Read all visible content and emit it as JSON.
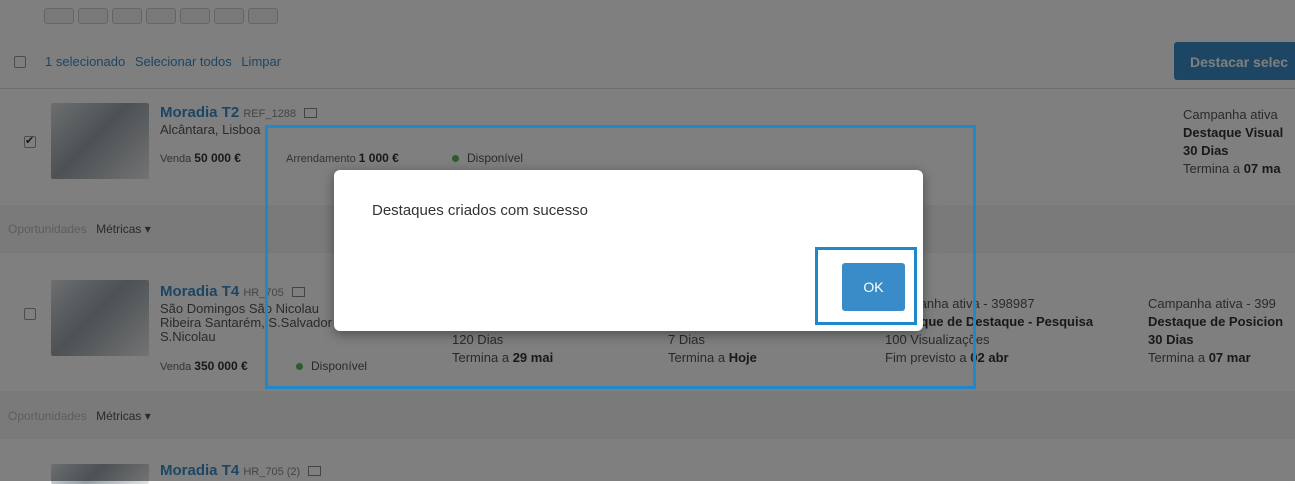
{
  "selection_bar": {
    "selected_count": "1 selecionado",
    "select_all": "Selecionar todos",
    "clear": "Limpar",
    "highlight_button": "Destacar selec"
  },
  "listings": [
    {
      "title": "Moradia T2",
      "ref": "REF_1288",
      "location": "Alcântara, Lisboa",
      "sale_label": "Venda",
      "sale_price": "50 000 €",
      "rent_label": "Arrendamento",
      "rent_price": "1 000 €",
      "status": "Disponível",
      "campaign": {
        "line1": "Campanha ativa",
        "line2": "Destaque Visual",
        "line3": "30 Dias",
        "line4_prefix": "Termina a",
        "line4_value": "07 ma"
      },
      "tabs": {
        "opportunities": "Oportunidades",
        "metrics": "Métricas ▾"
      }
    },
    {
      "title": "Moradia T4",
      "ref": "HR_705",
      "location_lines": [
        "São Domingos São Nicolau",
        "Ribeira Santarém, S.Salvador",
        "S.Nicolau"
      ],
      "sale_label": "Venda",
      "sale_price": "350 000 €",
      "status": "Disponível",
      "col_a": {
        "line3": "120 Dias",
        "line4_prefix": "Termina a",
        "line4_value": "29 mai"
      },
      "col_b": {
        "line3": "7 Dias",
        "line4_prefix": "Termina a",
        "line4_value": "Hoje"
      },
      "col_c": {
        "line1": "Campanha ativa - 398987",
        "line2": "Destaque de Destaque - Pesquisa",
        "line3": "100 Visualizações",
        "line4_prefix": "Fim previsto a",
        "line4_value": "02 abr"
      },
      "col_d": {
        "line1": "Campanha ativa - 399",
        "line2": "Destaque de Posicion",
        "line3": "30 Dias",
        "line4_prefix": "Termina a",
        "line4_value": "07 mar"
      },
      "tabs": {
        "opportunities": "Oportunidades",
        "metrics": "Métricas ▾"
      }
    },
    {
      "title": "Moradia T4",
      "ref": "HR_705 (2)"
    }
  ],
  "modal": {
    "message": "Destaques criados com sucesso",
    "ok_label": "OK"
  },
  "colors": {
    "accent": "#3a8cc8",
    "highlight_box": "#1e88c8",
    "available": "#5cb85c"
  }
}
